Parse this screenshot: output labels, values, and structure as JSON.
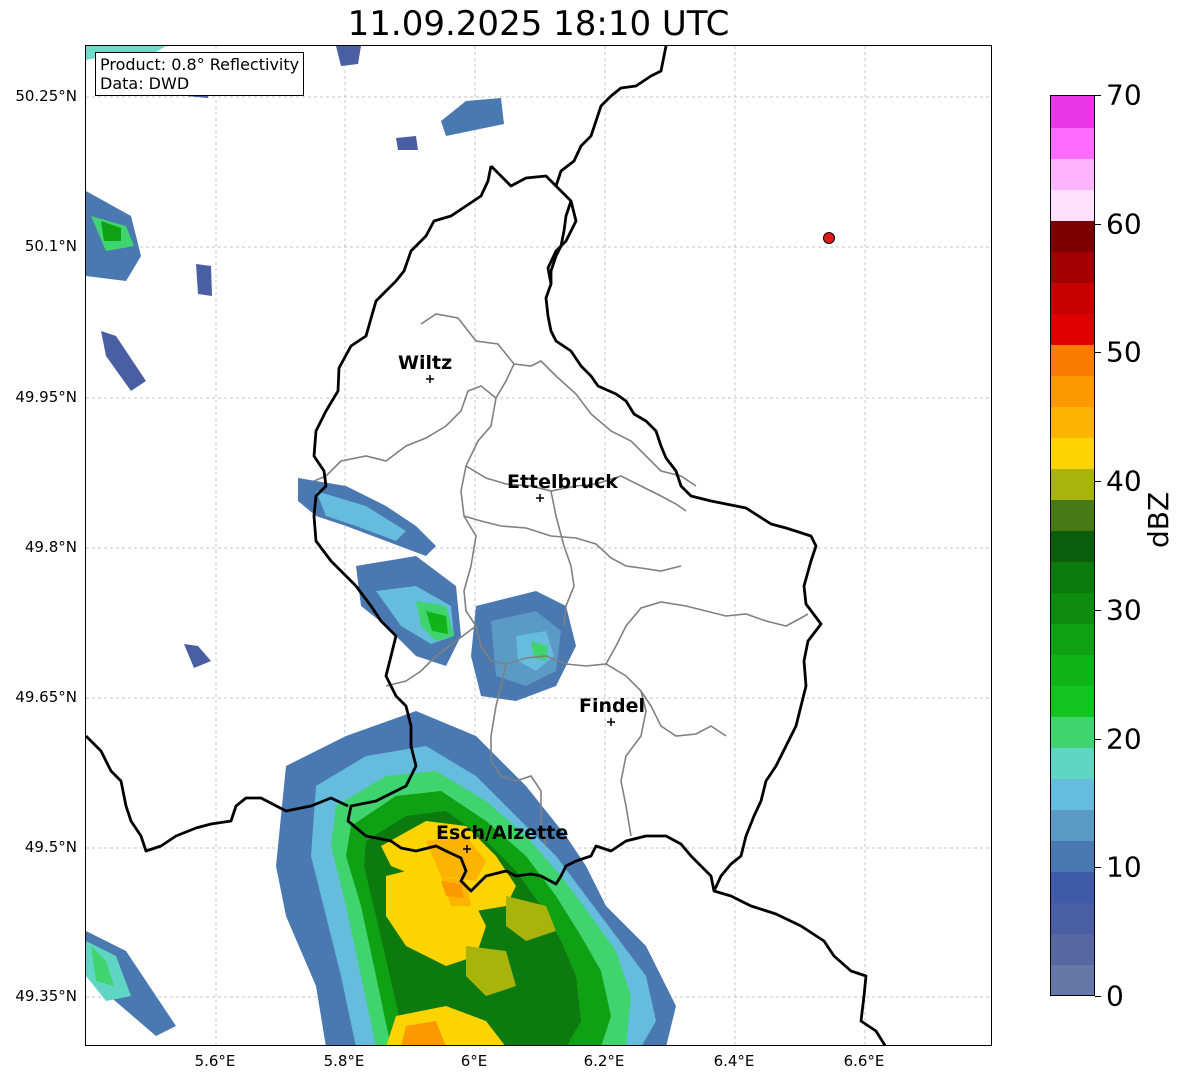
{
  "title": "11.09.2025 18:10 UTC",
  "info": {
    "product": "Product: 0.8° Reflectivity",
    "source": "Data: DWD"
  },
  "axes": {
    "lat_labels": [
      "50.25°N",
      "50.1°N",
      "49.95°N",
      "49.8°N",
      "49.65°N",
      "49.5°N",
      "49.35°N"
    ],
    "lon_labels": [
      "5.6°E",
      "5.8°E",
      "6°E",
      "6.2°E",
      "6.4°E",
      "6.6°E"
    ],
    "grid": true
  },
  "cities": [
    {
      "name": "Wiltz",
      "lat": 49.97,
      "lon": 5.93
    },
    {
      "name": "Ettelbruck",
      "lat": 49.85,
      "lon": 6.1
    },
    {
      "name": "Findel",
      "lat": 49.63,
      "lon": 6.21
    },
    {
      "name": "Esch/Alzette",
      "lat": 49.5,
      "lon": 5.99
    }
  ],
  "radar_site_marker": {
    "lat": 50.11,
    "lon": 6.55,
    "color": "#e31a1c"
  },
  "colorbar": {
    "label": "dBZ",
    "min": 0,
    "max": 70,
    "ticks": [
      "0",
      "10",
      "20",
      "30",
      "40",
      "50",
      "60",
      "70"
    ],
    "colors": [
      "#6678a8",
      "#57679f",
      "#4a5fa3",
      "#3f5aa8",
      "#4a78b0",
      "#5a9ac4",
      "#66bcdc",
      "#5fd6c4",
      "#3fd46e",
      "#14c41e",
      "#10b418",
      "#10a014",
      "#0e8c10",
      "#0c7a0e",
      "#0a5e0c",
      "#477a14",
      "#a8b40a",
      "#fcd400",
      "#fcb400",
      "#fc9800",
      "#fc7c00",
      "#e00000",
      "#c80000",
      "#a00000",
      "#7c0000",
      "#ffe0ff",
      "#ffb4ff",
      "#ff6cff",
      "#e836e8"
    ]
  }
}
